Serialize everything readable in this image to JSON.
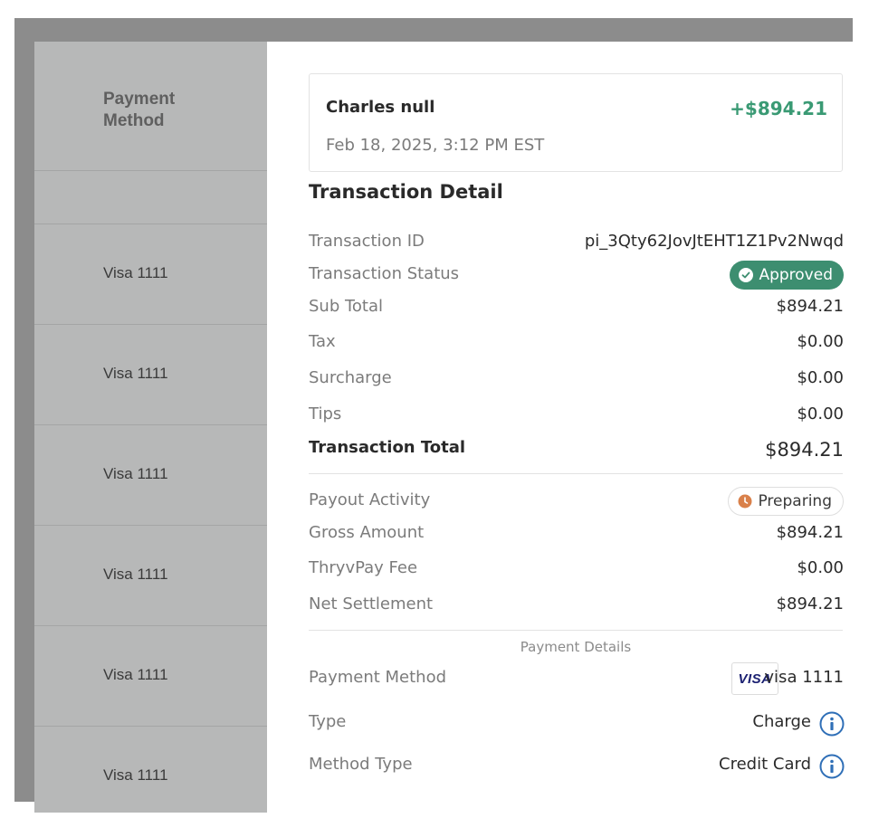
{
  "left_column": {
    "header": "Payment Method",
    "rows": [
      "Visa 1111",
      "Visa 1111",
      "Visa 1111",
      "Visa 1111",
      "Visa 1111",
      "Visa 1111"
    ]
  },
  "summary": {
    "customer_name": "Charles null",
    "amount": "+$894.21",
    "date": "Feb 18, 2025, 3:12 PM EST"
  },
  "transaction_detail": {
    "title": "Transaction Detail",
    "transaction_id_label": "Transaction ID",
    "transaction_id": "pi_3Qty62JovJtEHT1Z1Pv2Nwqd",
    "status_label": "Transaction Status",
    "status": "Approved",
    "subtotal_label": "Sub Total",
    "subtotal": "$894.21",
    "tax_label": "Tax",
    "tax": "$0.00",
    "surcharge_label": "Surcharge",
    "surcharge": "$0.00",
    "tips_label": "Tips",
    "tips": "$0.00",
    "total_label": "Transaction Total",
    "total": "$894.21"
  },
  "payout": {
    "activity_label": "Payout Activity",
    "activity_status": "Preparing",
    "gross_label": "Gross Amount",
    "gross": "$894.21",
    "fee_label": "ThryvPay Fee",
    "fee": "$0.00",
    "net_label": "Net Settlement",
    "net": "$894.21"
  },
  "payment_details": {
    "title": "Payment Details",
    "method_label": "Payment Method",
    "card_brand_logo": "VISA",
    "method": "visa 1111",
    "type_label": "Type",
    "type": "Charge",
    "method_type_label": "Method Type",
    "method_type": "Credit Card"
  },
  "colors": {
    "accent_green": "#3a9a74",
    "approved_badge": "#3d8e70",
    "preparing_icon": "#d9804a",
    "info_icon": "#2f6fb7",
    "left_column_bg": "#b7b8b8"
  },
  "icons": {
    "approved": "check-circle-icon",
    "preparing": "clock-icon",
    "info": "info-icon"
  }
}
